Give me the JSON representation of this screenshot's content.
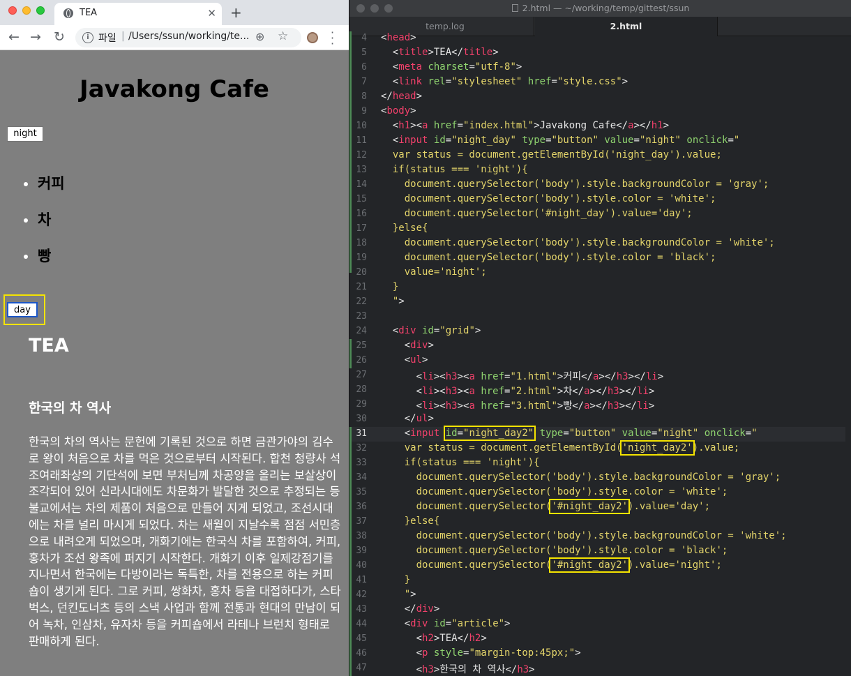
{
  "browser": {
    "tab_title": "TEA",
    "tab_close": "✕",
    "new_tab": "+",
    "address_scheme": "파일",
    "address_url": "/Users/ssun/working/te...",
    "page": {
      "site_title": "Javakong Cafe",
      "night_button": "night",
      "menu_items": [
        "커피",
        "차",
        "빵"
      ],
      "day_button": "day",
      "article_title": "TEA",
      "article_subtitle": "한국의 차 역사",
      "article_body": "한국의 차의 역사는 문헌에 기록된 것으로 하면 금관가야의 김수로 왕이 처음으로 차를 먹은 것으로부터 시작된다. 합천 청량사 석조여래좌상의 기단석에 보면 부처님께 차공양을 올리는 보살상이 조각되어 있어 신라시대에도 차문화가 발달한 것으로 추정되는 등 불교에서는 차의 제품이 처음으로 만들어 지게 되었고, 조선시대에는 차를 널리 마시게 되었다. 차는 새월이 지날수록 점점 서민층으로 내려오게 되었으며, 개화기에는 한국식 차를 포함하여, 커피, 홍차가 조선 왕족에 퍼지기 시작한다. 개화기 이후 일제강점기를 지나면서 한국에는 다방이라는 독특한, 차를 전용으로 하는 커피숍이 생기게 된다. 그로 커피, 쌍화차, 홍차 등을 대접하다가, 스타벅스, 던킨도너츠 등의 스낵 사업과 함께 전통과 현대의 만남이 되어 녹차, 인삼차, 유자차 등을 커피숍에서 라테나 브런치 형태로 판매하게 된다."
    }
  },
  "editor": {
    "window_title": "2.html — ~/working/temp/gittest/ssun",
    "tabs": [
      "temp.log",
      "2.html"
    ],
    "active_line": 31,
    "lines": [
      {
        "n": "4",
        "html": "<span class=\"pl\">&lt;</span><span class=\"tg\">head</span><span class=\"pl\">&gt;</span>"
      },
      {
        "n": "5",
        "html": "  <span class=\"pl\">&lt;</span><span class=\"tg\">title</span><span class=\"pl\">&gt;TEA&lt;/</span><span class=\"tg\">title</span><span class=\"pl\">&gt;</span>"
      },
      {
        "n": "6",
        "html": "  <span class=\"pl\">&lt;</span><span class=\"tg\">meta</span> <span class=\"at\">charset</span><span class=\"pl\">=</span><span class=\"st\">\"utf-8\"</span><span class=\"pl\">&gt;</span>"
      },
      {
        "n": "7",
        "html": "  <span class=\"pl\">&lt;</span><span class=\"tg\">link</span> <span class=\"at\">rel</span><span class=\"pl\">=</span><span class=\"st\">\"stylesheet\"</span> <span class=\"at\">href</span><span class=\"pl\">=</span><span class=\"st\">\"style.css\"</span><span class=\"pl\">&gt;</span>"
      },
      {
        "n": "8",
        "html": "<span class=\"pl\">&lt;/</span><span class=\"tg\">head</span><span class=\"pl\">&gt;</span>"
      },
      {
        "n": "9",
        "html": "<span class=\"pl\">&lt;</span><span class=\"tg\">body</span><span class=\"pl\">&gt;</span>"
      },
      {
        "n": "10",
        "html": "  <span class=\"pl\">&lt;</span><span class=\"tg\">h1</span><span class=\"pl\">&gt;&lt;</span><span class=\"tg\">a</span> <span class=\"at\">href</span><span class=\"pl\">=</span><span class=\"st\">\"index.html\"</span><span class=\"pl\">&gt;Javakong Cafe&lt;/</span><span class=\"tg\">a</span><span class=\"pl\">&gt;&lt;/</span><span class=\"tg\">h1</span><span class=\"pl\">&gt;</span>"
      },
      {
        "n": "11",
        "html": "  <span class=\"pl\">&lt;</span><span class=\"tg\">input</span> <span class=\"at\">id</span><span class=\"pl\">=</span><span class=\"st\">\"night_day\"</span> <span class=\"at\">type</span><span class=\"pl\">=</span><span class=\"st\">\"button\"</span> <span class=\"at\">value</span><span class=\"pl\">=</span><span class=\"st\">\"night\"</span> <span class=\"at\">onclick</span><span class=\"pl\">=</span><span class=\"st\">\"</span>"
      },
      {
        "n": "12",
        "html": "  <span class=\"st\">var status = document.getElementById('night_day').value;</span>"
      },
      {
        "n": "13",
        "html": "  <span class=\"st\">if(status === 'night'){</span>"
      },
      {
        "n": "14",
        "html": "    <span class=\"st\">document.querySelector('body').style.backgroundColor = 'gray';</span>"
      },
      {
        "n": "15",
        "html": "    <span class=\"st\">document.querySelector('body').style.color = 'white';</span>"
      },
      {
        "n": "16",
        "html": "    <span class=\"st\">document.querySelector('#night_day').value='day';</span>"
      },
      {
        "n": "17",
        "html": "  <span class=\"st\">}else{</span>"
      },
      {
        "n": "18",
        "html": "    <span class=\"st\">document.querySelector('body').style.backgroundColor = 'white';</span>"
      },
      {
        "n": "19",
        "html": "    <span class=\"st\">document.querySelector('body').style.color = 'black';</span>"
      },
      {
        "n": "20",
        "html": "    <span class=\"st\">value='night';</span>"
      },
      {
        "n": "21",
        "html": "  <span class=\"st\">}</span>"
      },
      {
        "n": "22",
        "html": "  <span class=\"st\">\"</span><span class=\"pl\">&gt;</span>"
      },
      {
        "n": "23",
        "html": ""
      },
      {
        "n": "24",
        "html": "  <span class=\"pl\">&lt;</span><span class=\"tg\">div</span> <span class=\"at\">id</span><span class=\"pl\">=</span><span class=\"st\">\"grid\"</span><span class=\"pl\">&gt;</span>"
      },
      {
        "n": "25",
        "html": "    <span class=\"pl\">&lt;</span><span class=\"tg\">div</span><span class=\"pl\">&gt;</span>"
      },
      {
        "n": "26",
        "html": "    <span class=\"pl\">&lt;</span><span class=\"tg\">ul</span><span class=\"pl\">&gt;</span>"
      },
      {
        "n": "27",
        "html": "      <span class=\"pl\">&lt;</span><span class=\"tg\">li</span><span class=\"pl\">&gt;&lt;</span><span class=\"tg\">h3</span><span class=\"pl\">&gt;&lt;</span><span class=\"tg\">a</span> <span class=\"at\">href</span><span class=\"pl\">=</span><span class=\"st\">\"1.html\"</span><span class=\"pl\">&gt;커피&lt;/</span><span class=\"tg\">a</span><span class=\"pl\">&gt;&lt;/</span><span class=\"tg\">h3</span><span class=\"pl\">&gt;&lt;/</span><span class=\"tg\">li</span><span class=\"pl\">&gt;</span>"
      },
      {
        "n": "28",
        "html": "      <span class=\"pl\">&lt;</span><span class=\"tg\">li</span><span class=\"pl\">&gt;&lt;</span><span class=\"tg\">h3</span><span class=\"pl\">&gt;&lt;</span><span class=\"tg\">a</span> <span class=\"at\">href</span><span class=\"pl\">=</span><span class=\"st\">\"2.html\"</span><span class=\"pl\">&gt;차&lt;/</span><span class=\"tg\">a</span><span class=\"pl\">&gt;&lt;/</span><span class=\"tg\">h3</span><span class=\"pl\">&gt;&lt;/</span><span class=\"tg\">li</span><span class=\"pl\">&gt;</span>"
      },
      {
        "n": "29",
        "html": "      <span class=\"pl\">&lt;</span><span class=\"tg\">li</span><span class=\"pl\">&gt;&lt;</span><span class=\"tg\">h3</span><span class=\"pl\">&gt;&lt;</span><span class=\"tg\">a</span> <span class=\"at\">href</span><span class=\"pl\">=</span><span class=\"st\">\"3.html\"</span><span class=\"pl\">&gt;빵&lt;/</span><span class=\"tg\">a</span><span class=\"pl\">&gt;&lt;/</span><span class=\"tg\">h3</span><span class=\"pl\">&gt;&lt;/</span><span class=\"tg\">li</span><span class=\"pl\">&gt;</span>"
      },
      {
        "n": "30",
        "html": "    <span class=\"pl\">&lt;/</span><span class=\"tg\">ul</span><span class=\"pl\">&gt;</span>"
      },
      {
        "n": "31",
        "html": "    <span class=\"pl\">&lt;</span><span class=\"tg\">input</span> <span class=\"hl\"><span class=\"at\">id</span><span class=\"pl\">=</span><span class=\"st\">\"night_day2\"</span></span> <span class=\"at\">type</span><span class=\"pl\">=</span><span class=\"st\">\"button\"</span> <span class=\"at\">value</span><span class=\"pl\">=</span><span class=\"st\">\"night\"</span> <span class=\"at\">onclick</span><span class=\"pl\">=</span><span class=\"st\">\"</span>"
      },
      {
        "n": "32",
        "html": "    <span class=\"st\">var status = document.getElementById(</span><span class=\"st hl\">'night_day2'</span><span class=\"st\">).value;</span>"
      },
      {
        "n": "33",
        "html": "    <span class=\"st\">if(status === 'night'){</span>"
      },
      {
        "n": "34",
        "html": "      <span class=\"st\">document.querySelector('body').style.backgroundColor = 'gray';</span>"
      },
      {
        "n": "35",
        "html": "      <span class=\"st\">document.querySelector('body').style.color = 'white';</span>"
      },
      {
        "n": "36",
        "html": "      <span class=\"st\">document.querySelector(</span><span class=\"st hl\">'#night_day2'</span><span class=\"st\">).value='day';</span>"
      },
      {
        "n": "37",
        "html": "    <span class=\"st\">}else{</span>"
      },
      {
        "n": "38",
        "html": "      <span class=\"st\">document.querySelector('body').style.backgroundColor = 'white';</span>"
      },
      {
        "n": "39",
        "html": "      <span class=\"st\">document.querySelector('body').style.color = 'black';</span>"
      },
      {
        "n": "40",
        "html": "      <span class=\"st\">document.querySelector(</span><span class=\"st hl\">'#night_day2'</span><span class=\"st\">).value='night';</span>"
      },
      {
        "n": "41",
        "html": "    <span class=\"st\">}</span>"
      },
      {
        "n": "42",
        "html": "    <span class=\"st\">\"</span><span class=\"pl\">&gt;</span>"
      },
      {
        "n": "43",
        "html": "    <span class=\"pl\">&lt;/</span><span class=\"tg\">div</span><span class=\"pl\">&gt;</span>"
      },
      {
        "n": "44",
        "html": "    <span class=\"pl\">&lt;</span><span class=\"tg\">div</span> <span class=\"at\">id</span><span class=\"pl\">=</span><span class=\"st\">\"article\"</span><span class=\"pl\">&gt;</span>"
      },
      {
        "n": "45",
        "html": "      <span class=\"pl\">&lt;</span><span class=\"tg\">h2</span><span class=\"pl\">&gt;TEA&lt;/</span><span class=\"tg\">h2</span><span class=\"pl\">&gt;</span>"
      },
      {
        "n": "46",
        "html": "      <span class=\"pl\">&lt;</span><span class=\"tg\">p</span> <span class=\"at\">style</span><span class=\"pl\">=</span><span class=\"st\">\"margin-top:45px;\"</span><span class=\"pl\">&gt;</span>"
      },
      {
        "n": "47",
        "html": "      <span class=\"pl\">&lt;</span><span class=\"tg\">h3</span><span class=\"pl\">&gt;한국의 차 역사&lt;/</span><span class=\"tg\">h3</span><span class=\"pl\">&gt;</span>"
      }
    ]
  }
}
